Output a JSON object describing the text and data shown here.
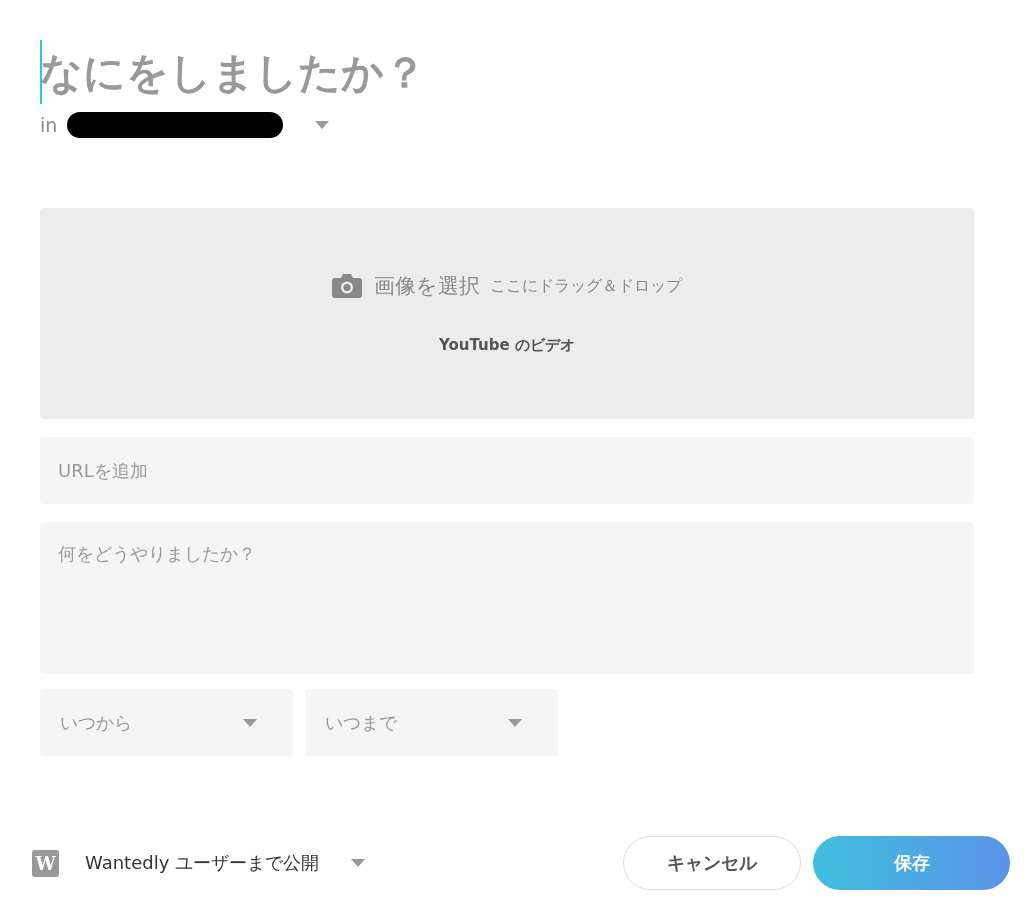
{
  "title_field": {
    "placeholder": "なにをしましたか？",
    "focused": true
  },
  "company": {
    "prefix": "in"
  },
  "upload": {
    "button": "画像を選択",
    "hint": "ここにドラッグ＆ドロップ",
    "video_link": "YouTube のビデオ"
  },
  "url_field": {
    "placeholder": "URLを追加"
  },
  "description_field": {
    "placeholder": "何をどうやりましたか？"
  },
  "dates": [
    {
      "placeholder": "いつから"
    },
    {
      "placeholder": "いつまで"
    }
  ],
  "visibility": {
    "logo": "W",
    "label": "Wantedly ユーザーまで公開"
  },
  "buttons": [
    {
      "label": "キャンセル",
      "kind": "secondary"
    },
    {
      "label": "保存",
      "kind": "primary"
    }
  ]
}
